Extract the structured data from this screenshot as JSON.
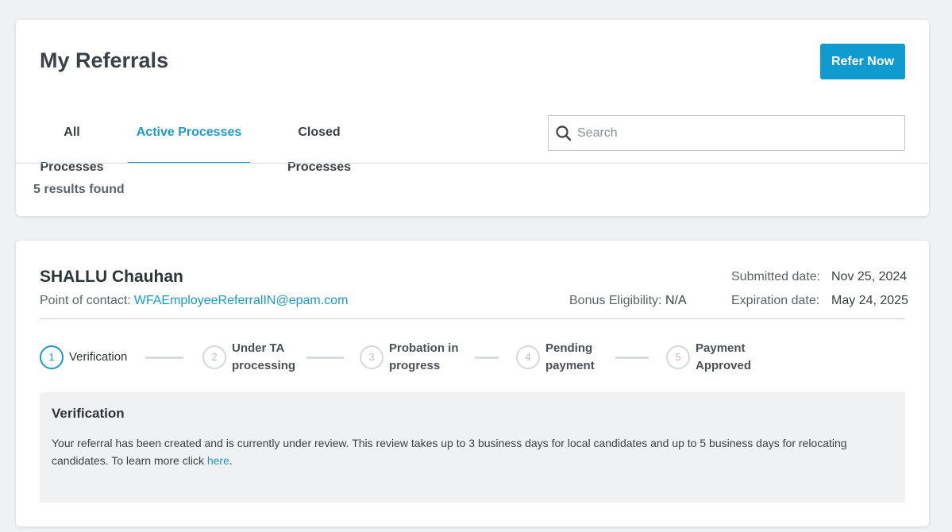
{
  "header": {
    "title": "My Referrals",
    "refer_button": "Refer Now"
  },
  "tabs": [
    {
      "label": "All Processes",
      "active": false
    },
    {
      "label": "Active Processes",
      "active": true
    },
    {
      "label": "Closed Processes",
      "active": false
    }
  ],
  "search": {
    "placeholder": "Search",
    "value": "",
    "icon": "search-icon"
  },
  "results_text": "5 results found",
  "referral": {
    "candidate_name": "SHALLU Chauhan",
    "poc_label": "Point of contact:",
    "poc_email": "WFAEmployeeReferralIN@epam.com",
    "bonus_label": "Bonus Eligibility:",
    "bonus_value": "N/A",
    "submitted_label": "Submitted date:",
    "submitted_value": "Nov 25, 2024",
    "expiration_label": "Expiration date:",
    "expiration_value": "May 24, 2025",
    "steps": [
      {
        "number": "1",
        "line1": "Verification",
        "line2": "",
        "active": true
      },
      {
        "number": "2",
        "line1": "Under TA",
        "line2": "processing",
        "active": false
      },
      {
        "number": "3",
        "line1": "Probation in",
        "line2": "progress",
        "active": false
      },
      {
        "number": "4",
        "line1": "Pending",
        "line2": "payment",
        "active": false
      },
      {
        "number": "5",
        "line1": "Payment",
        "line2": "Approved",
        "active": false
      }
    ],
    "info": {
      "title": "Verification",
      "body": "Your referral has been created and is currently under review. This review takes up to 3 business days for local candidates and up to 5 business days for relocating candidates. To learn more click",
      "link_text": "here",
      "trailing": "."
    }
  },
  "colors": {
    "accent": "#0f9bd0",
    "link": "#1b9ac4",
    "background": "#f0f1f3"
  }
}
